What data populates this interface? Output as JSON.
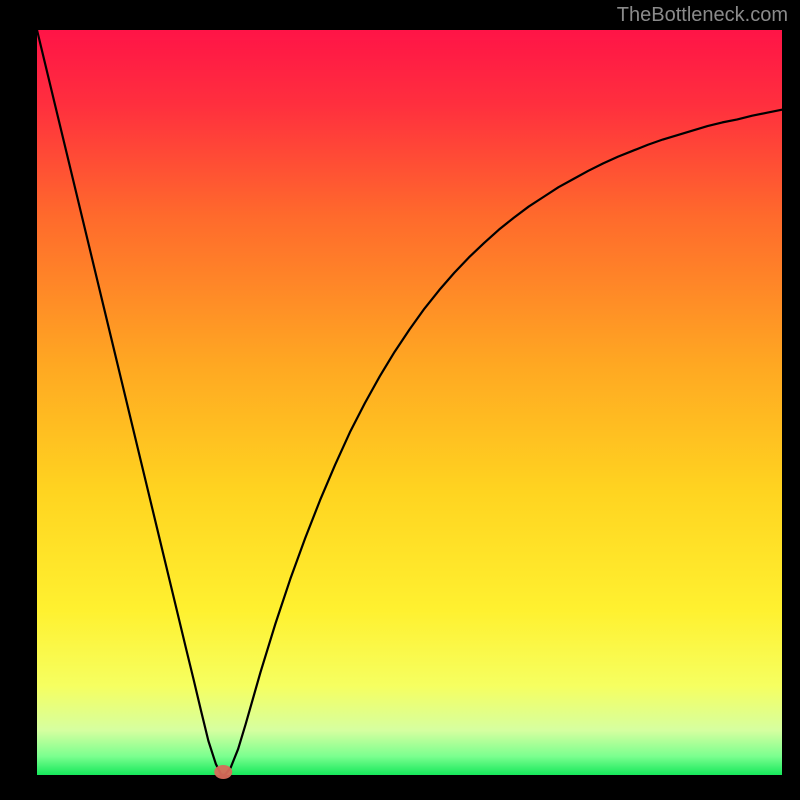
{
  "watermark": "TheBottleneck.com",
  "colors": {
    "frame": "#000000",
    "curve": "#000000",
    "marker": "#d86a5a",
    "gradient_stops": [
      "#ff1447",
      "#ff2f3e",
      "#ff6a2c",
      "#ffa822",
      "#ffd420",
      "#fff130",
      "#f6ff60",
      "#d6ffa0",
      "#7bff8f",
      "#16e85b"
    ]
  },
  "chart_data": {
    "type": "line",
    "title": "",
    "xlabel": "",
    "ylabel": "",
    "xlim": [
      0,
      1
    ],
    "ylim": [
      0,
      100
    ],
    "x": [
      0.0,
      0.02,
      0.04,
      0.06,
      0.08,
      0.1,
      0.12,
      0.14,
      0.16,
      0.18,
      0.2,
      0.21,
      0.22,
      0.23,
      0.24,
      0.247,
      0.25,
      0.253,
      0.26,
      0.27,
      0.28,
      0.3,
      0.32,
      0.34,
      0.36,
      0.38,
      0.4,
      0.42,
      0.44,
      0.46,
      0.48,
      0.5,
      0.52,
      0.54,
      0.56,
      0.58,
      0.6,
      0.62,
      0.64,
      0.66,
      0.68,
      0.7,
      0.72,
      0.74,
      0.76,
      0.78,
      0.8,
      0.82,
      0.84,
      0.86,
      0.88,
      0.9,
      0.92,
      0.94,
      0.96,
      0.98,
      1.0
    ],
    "values": [
      100.0,
      91.7,
      83.4,
      75.1,
      66.8,
      58.5,
      50.2,
      41.9,
      33.6,
      25.3,
      17.0,
      12.9,
      8.7,
      4.6,
      1.5,
      0.1,
      0.0,
      0.1,
      1.0,
      3.5,
      6.8,
      13.8,
      20.3,
      26.3,
      31.8,
      36.9,
      41.6,
      46.0,
      49.9,
      53.5,
      56.8,
      59.8,
      62.6,
      65.1,
      67.4,
      69.5,
      71.4,
      73.2,
      74.8,
      76.3,
      77.6,
      78.9,
      80.0,
      81.1,
      82.1,
      83.0,
      83.8,
      84.6,
      85.3,
      85.9,
      86.5,
      87.1,
      87.6,
      88.0,
      88.5,
      88.9,
      89.3
    ],
    "min_point": {
      "x": 0.25,
      "y": 0.0
    },
    "annotations": []
  }
}
